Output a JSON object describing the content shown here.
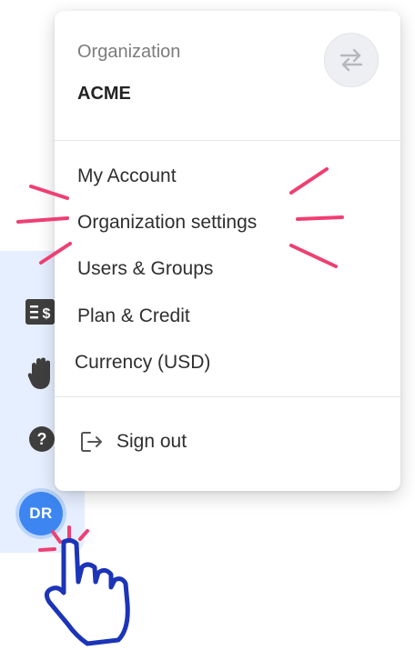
{
  "colors": {
    "accent": "#3d86f1",
    "highlight_marks": "#ef3f72",
    "pointer_outline": "#1c34b8",
    "sidebar_bg": "#e6efff"
  },
  "sidebar": {
    "icons": [
      "billing-icon",
      "hand-icon",
      "help-icon"
    ],
    "avatar_initials": "DR"
  },
  "menu": {
    "org_label": "Organization",
    "org_name": "ACME",
    "switch_icon": "swap-arrows-icon",
    "items": [
      {
        "label": "My Account"
      },
      {
        "label": "Organization settings"
      },
      {
        "label": "Users & Groups"
      },
      {
        "label": "Plan & Credit"
      },
      {
        "label": "Currency (USD)"
      }
    ],
    "sign_out": {
      "label": "Sign out",
      "icon": "sign-out-icon"
    }
  },
  "annotations": {
    "highlighted_item": "Organization settings",
    "pointer_icon": "hand-pointer-icon"
  }
}
